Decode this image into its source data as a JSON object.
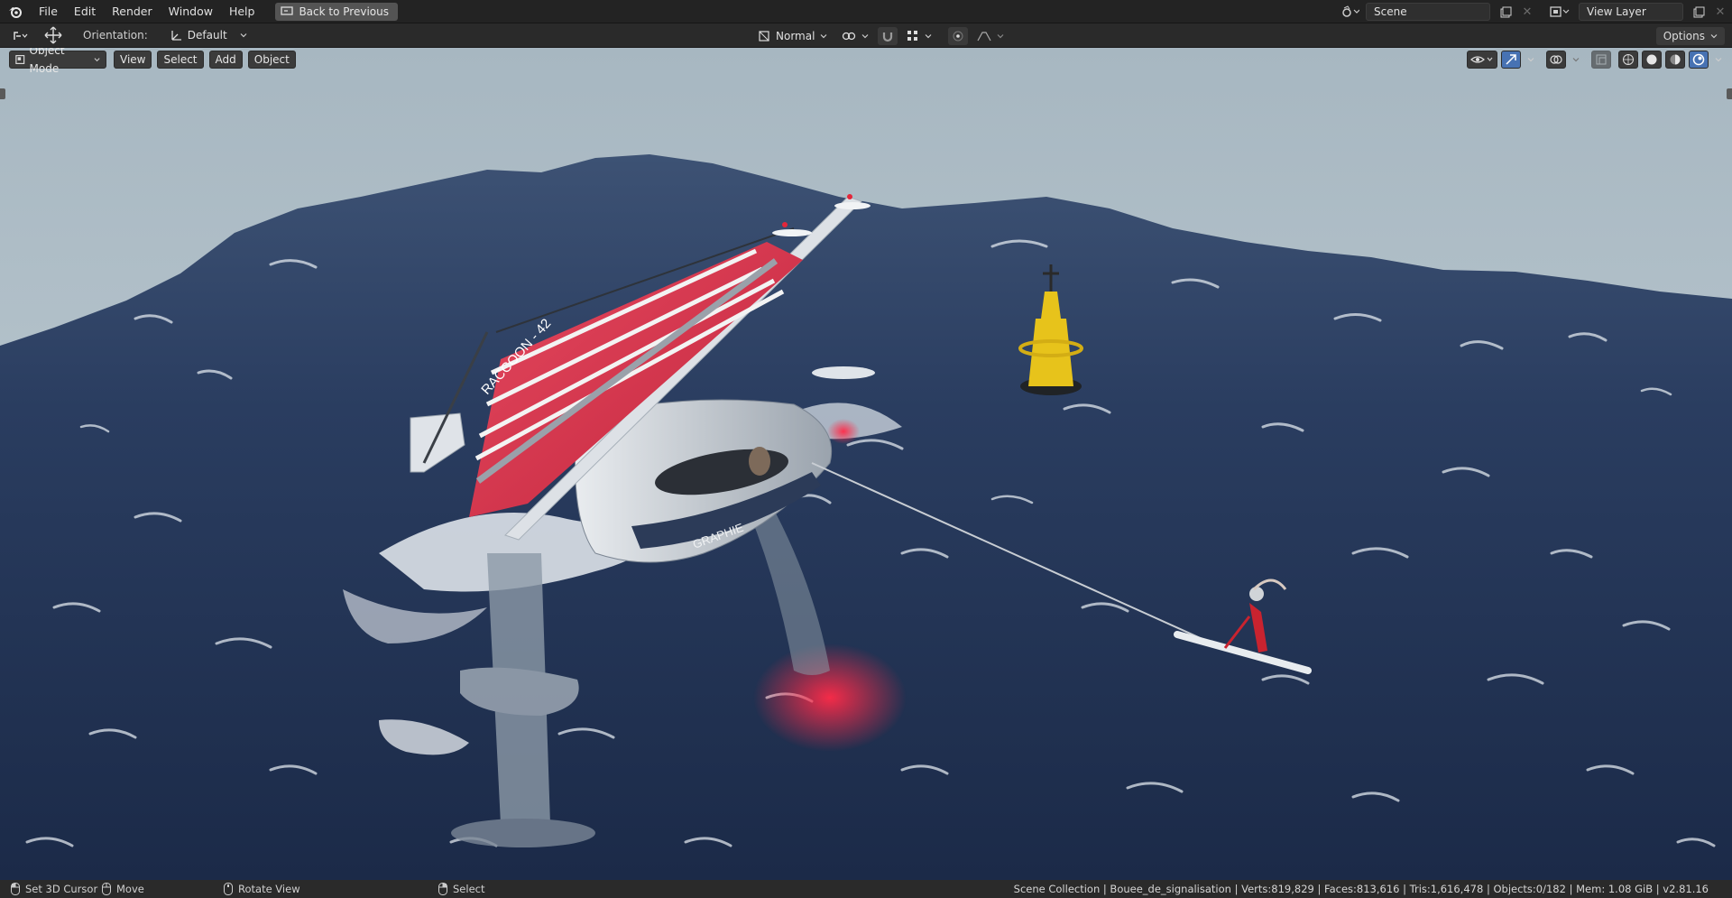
{
  "topbar": {
    "menus": [
      "File",
      "Edit",
      "Render",
      "Window",
      "Help"
    ],
    "back_button": "Back to Previous",
    "scene_name": "Scene",
    "view_layer": "View Layer"
  },
  "toolheader": {
    "orientation_label": "Orientation:",
    "orientation_value": "Default",
    "pivot_value": "Normal",
    "options_label": "Options"
  },
  "viewport": {
    "mode": "Object Mode",
    "menus": [
      "View",
      "Select",
      "Add",
      "Object"
    ],
    "boat_name": "RACCOON - 42",
    "hull_text": "GRAPHIE"
  },
  "statusbar": {
    "left_action": "Set 3D Cursor",
    "middle_action": "Move",
    "right_action": "Rotate View",
    "select_action": "Select",
    "stats": "Scene Collection | Bouee_de_signalisation | Verts:819,829 | Faces:813,616 | Tris:1,616,478 | Objects:0/182 | Mem: 1.08 GiB | v2.81.16"
  },
  "colors": {
    "ui_bg": "#232323",
    "active_blue": "#4772b3",
    "sky": "#b3c2cb",
    "sea": "#24375a",
    "sail_red": "#d6314a",
    "buoy_yellow": "#e7c31b"
  }
}
